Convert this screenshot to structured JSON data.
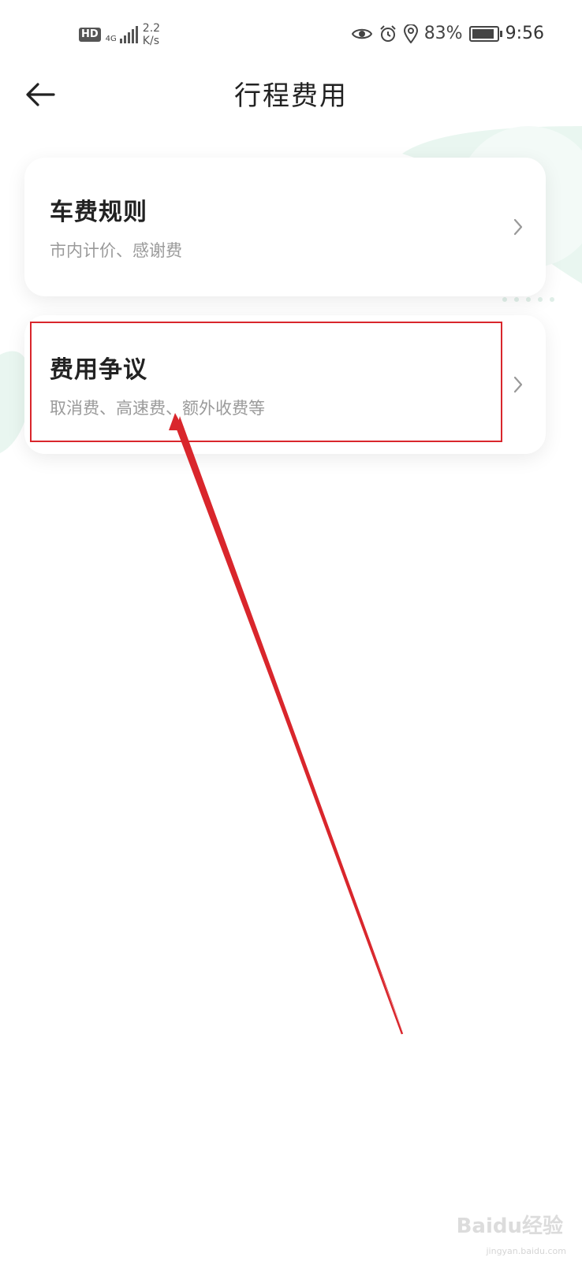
{
  "status_bar": {
    "hd": "HD",
    "network": "4G",
    "speed_value": "2.2",
    "speed_unit": "K/s",
    "battery": "83%",
    "time": "9:56",
    "icons": [
      "eye-icon",
      "alarm-icon",
      "location-icon",
      "battery-icon"
    ]
  },
  "header": {
    "title": "行程费用",
    "back_icon": "arrow-left-icon"
  },
  "cards": [
    {
      "title": "车费规则",
      "subtitle": "市内计价、感谢费",
      "icon": "chevron-right-icon"
    },
    {
      "title": "费用争议",
      "subtitle": "取消费、高速费、额外收费等",
      "icon": "chevron-right-icon"
    }
  ],
  "annotation": {
    "highlight_color": "#d9262c",
    "arrow_color": "#d9262c"
  },
  "watermark": {
    "text": "Baidu经验",
    "sub": "jingyan.baidu.com"
  },
  "colors": {
    "accent_deco": "#e6f4ee",
    "subtitle": "#9a9a9a"
  }
}
